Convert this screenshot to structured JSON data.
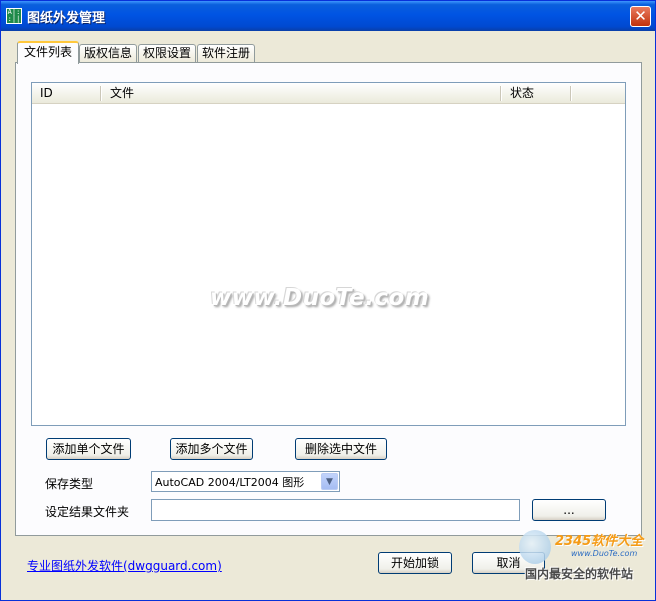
{
  "window": {
    "title": "图纸外发管理",
    "icon": "app-logo-icon",
    "close_icon": "close-icon"
  },
  "tabs": [
    {
      "label": "文件列表",
      "active": true
    },
    {
      "label": "版权信息",
      "active": false
    },
    {
      "label": "权限设置",
      "active": false
    },
    {
      "label": "软件注册",
      "active": false
    }
  ],
  "file_list": {
    "columns": [
      "ID",
      "文件",
      "状态"
    ],
    "rows": []
  },
  "watermark": "www.DuoTe.com",
  "actions": {
    "add_single": "添加单个文件",
    "add_multiple": "添加多个文件",
    "delete_selected": "删除选中文件"
  },
  "save_type": {
    "label": "保存类型",
    "value": "AutoCAD 2004/LT2004 图形"
  },
  "output_folder": {
    "label": "设定结果文件夹",
    "value": "",
    "browse_label": "..."
  },
  "footer": {
    "link_text": "专业图纸外发软件(dwgguard.com)",
    "start_button": "开始加锁",
    "cancel_button": "取消"
  },
  "site_badge": {
    "top_text": "2345软件大全",
    "url": "www.DuoTe.com",
    "bottom_text": "国内最安全的软件站"
  },
  "colors": {
    "titlebar": "#0054e3",
    "window_bg": "#ece9d8",
    "link": "#0000ff",
    "active_tab_accent": "#ffc83c"
  }
}
